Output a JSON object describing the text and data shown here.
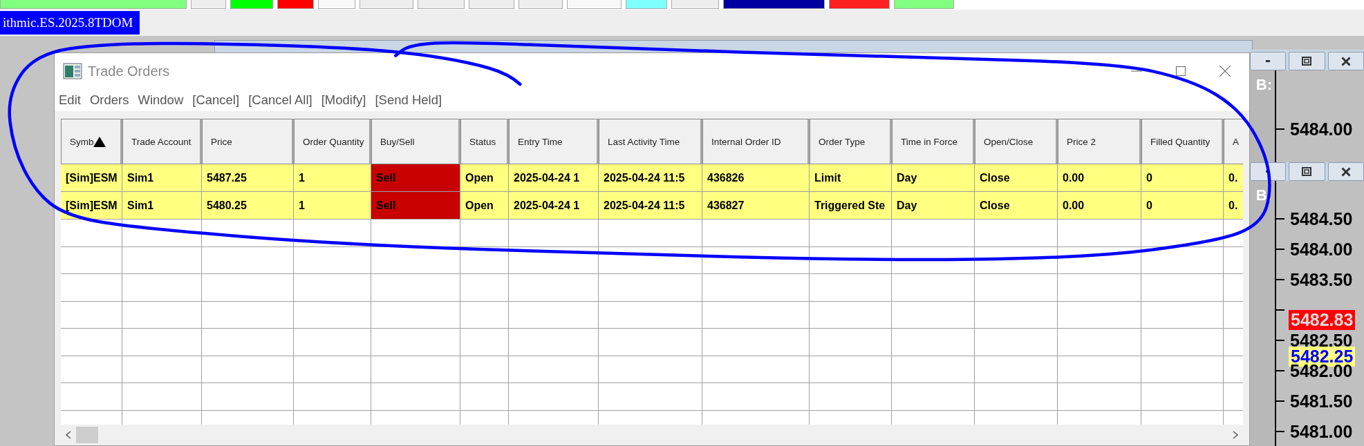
{
  "toolbar": {
    "buttons": [
      {
        "color": "#80ff80"
      },
      {
        "color": "#eeeeee"
      },
      {
        "color": "#00ff00"
      },
      {
        "color": "#ff0000"
      },
      {
        "color": "#f8f8f8"
      },
      {
        "color": "#eeeeee"
      },
      {
        "color": "#eeeeee"
      },
      {
        "color": "#eeeeee"
      },
      {
        "color": "#eeeeee"
      },
      {
        "color": "#f8f8f8"
      },
      {
        "color": "#80ffff"
      },
      {
        "color": "#eeeeee"
      },
      {
        "color": "#0000a0"
      },
      {
        "color": "#ff2020"
      },
      {
        "color": "#80ff80"
      }
    ]
  },
  "chart_tab": {
    "label": "ithmic.ES.2025.8TDOM"
  },
  "trade_orders": {
    "title": "Trade Orders",
    "menu": [
      "Edit",
      "Orders",
      "Window",
      "[Cancel]",
      "[Cancel All]",
      "[Modify]",
      "[Send Held]"
    ],
    "table": {
      "columns": [
        {
          "label": "Symb",
          "sorted": true
        },
        {
          "label": "Trade Account",
          "sorted": false
        },
        {
          "label": "Price",
          "sorted": false
        },
        {
          "label": "Order Quantity",
          "sorted": false
        },
        {
          "label": "Buy/Sell",
          "sorted": false
        },
        {
          "label": "Status",
          "sorted": false
        },
        {
          "label": "Entry Time",
          "sorted": false
        },
        {
          "label": "Last Activity Time",
          "sorted": false
        },
        {
          "label": "Internal Order ID",
          "sorted": false
        },
        {
          "label": "Order Type",
          "sorted": false
        },
        {
          "label": "Time in Force",
          "sorted": false
        },
        {
          "label": "Open/Close",
          "sorted": false
        },
        {
          "label": "Price 2",
          "sorted": false
        },
        {
          "label": "Filled Quantity",
          "sorted": false
        },
        {
          "label": "A",
          "sorted": false
        }
      ],
      "rows": [
        {
          "cells": [
            "[Sim]ESM",
            "Sim1",
            "5487.25",
            "1",
            {
              "text": "Sell",
              "color": "#c80000"
            },
            "Open",
            "2025-04-24  1",
            "2025-04-24  11:5",
            "436826",
            "Limit",
            "Day",
            "Close",
            "0.00",
            "0",
            "0."
          ]
        },
        {
          "cells": [
            "[Sim]ESM",
            "Sim1",
            "5480.25",
            "1",
            {
              "text": "Sell",
              "color": "#c80000"
            },
            "Open",
            "2025-04-24  1",
            "2025-04-24  11:5",
            "436827",
            "Triggered Ste",
            "Day",
            "Close",
            "0.00",
            "0",
            "0."
          ]
        }
      ]
    }
  },
  "dom_windows": [
    {
      "label": "B:",
      "ladder": [
        {
          "kind": "tick",
          "text": "5484.00"
        }
      ]
    },
    {
      "label": "B:",
      "ladder": [
        {
          "kind": "tick",
          "text": "5484.50"
        },
        {
          "kind": "tick",
          "text": "5484.00"
        },
        {
          "kind": "tick",
          "text": "5483.50"
        },
        {
          "kind": "tick"
        },
        {
          "kind": "ask",
          "text": "5482.83"
        },
        {
          "kind": "tick",
          "text": "5482.50"
        },
        {
          "kind": "last",
          "text": "5482.25"
        },
        {
          "kind": "tick",
          "text": "5482.00"
        },
        {
          "kind": "tick",
          "text": "5481.50"
        },
        {
          "kind": "tick",
          "text": "5481.00"
        }
      ]
    }
  ]
}
